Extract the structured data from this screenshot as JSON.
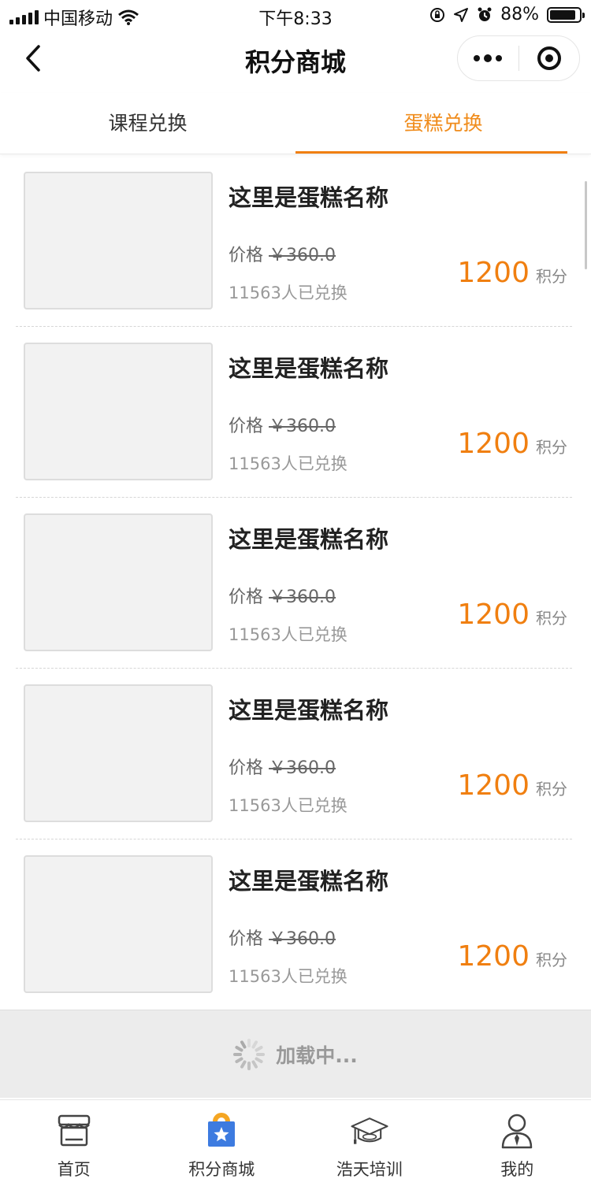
{
  "status_bar": {
    "carrier": "中国移动",
    "time": "下午8:33",
    "battery": "88%",
    "battery_level": 0.88
  },
  "nav": {
    "title": "积分商城"
  },
  "tabs": [
    {
      "label": "课程兑换",
      "active": false
    },
    {
      "label": "蛋糕兑换",
      "active": true
    }
  ],
  "items": [
    {
      "name": "这里是蛋糕名称",
      "price_label": "价格",
      "price": "￥360.0",
      "sold": "11563人已兑换",
      "points": "1200",
      "points_unit": "积分"
    },
    {
      "name": "这里是蛋糕名称",
      "price_label": "价格",
      "price": "￥360.0",
      "sold": "11563人已兑换",
      "points": "1200",
      "points_unit": "积分"
    },
    {
      "name": "这里是蛋糕名称",
      "price_label": "价格",
      "price": "￥360.0",
      "sold": "11563人已兑换",
      "points": "1200",
      "points_unit": "积分"
    },
    {
      "name": "这里是蛋糕名称",
      "price_label": "价格",
      "price": "￥360.0",
      "sold": "11563人已兑换",
      "points": "1200",
      "points_unit": "积分"
    },
    {
      "name": "这里是蛋糕名称",
      "price_label": "价格",
      "price": "￥360.0",
      "sold": "11563人已兑换",
      "points": "1200",
      "points_unit": "积分"
    }
  ],
  "loading": {
    "text": "加载中..."
  },
  "tabbar": [
    {
      "label": "首页",
      "icon": "store-icon"
    },
    {
      "label": "积分商城",
      "icon": "shopping-bag-star-icon"
    },
    {
      "label": "浩天培训",
      "icon": "graduation-cap-icon"
    },
    {
      "label": "我的",
      "icon": "user-icon"
    }
  ],
  "colors": {
    "accent": "#f07f10",
    "text": "#222222",
    "muted": "#999999"
  }
}
